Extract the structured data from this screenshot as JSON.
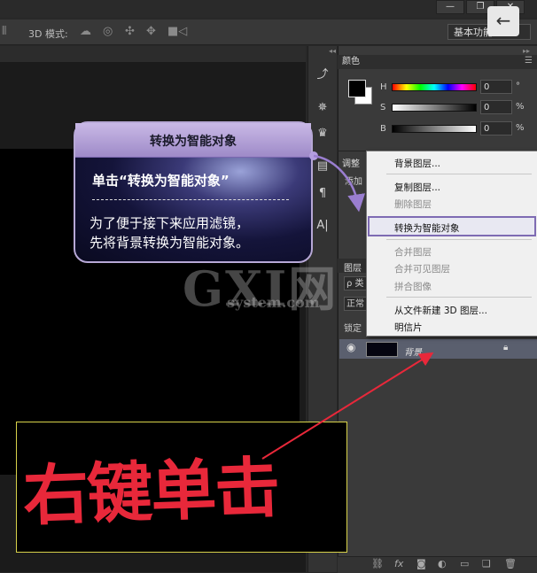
{
  "window": {
    "buttons": [
      "—",
      "❐",
      "✕"
    ],
    "back_glyph": "←"
  },
  "options_bar": {
    "mode_label": "3D 模式:",
    "workspace": "基本功能"
  },
  "color_panel": {
    "tab": "颜色",
    "rows": [
      {
        "label": "H",
        "value": "0",
        "unit": "°"
      },
      {
        "label": "S",
        "value": "0",
        "unit": "%"
      },
      {
        "label": "B",
        "value": "0",
        "unit": "%"
      }
    ]
  },
  "adjust_panel": {
    "tab": "调整",
    "add_text": "添加"
  },
  "layers_panel": {
    "tab": "图层",
    "search_glyph": "ρ 类",
    "blend_mode": "正常",
    "lock_label": "锁定",
    "layer": {
      "name": "背景"
    }
  },
  "context_menu": {
    "items": [
      {
        "label": "背景图层...",
        "disabled": false
      },
      {
        "label": "复制图层...",
        "disabled": false
      },
      {
        "label": "删除图层",
        "disabled": true
      },
      {
        "label": "转换为智能对象",
        "disabled": false,
        "highlighted": true
      },
      {
        "label": "合并图层",
        "disabled": true
      },
      {
        "label": "合并可见图层",
        "disabled": true
      },
      {
        "label": "拼合图像",
        "disabled": true
      },
      {
        "label": "从文件新建 3D 图层...",
        "disabled": false
      },
      {
        "label": "明信片",
        "disabled": false
      }
    ]
  },
  "callout": {
    "title": "转换为智能对象",
    "subtitle": "单击“转换为智能对象”",
    "body_line1": "为了便于接下来应用滤镜，",
    "body_line2": "先将背景转换为智能对象。"
  },
  "watermark": {
    "logo": "GXI网",
    "site": "system.com"
  },
  "annotation": {
    "text": "右键单击",
    "color": "#e8283a"
  },
  "accent_color": "#7e6bb3"
}
